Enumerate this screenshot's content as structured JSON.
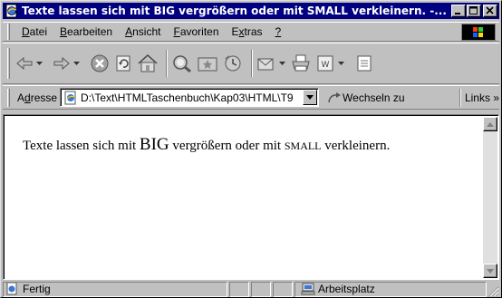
{
  "window": {
    "title": "Texte lassen sich mit BIG vergrößern oder mit SMALL verkleinern. -...",
    "title_bar_color": "#000080"
  },
  "menu": {
    "items": [
      {
        "label": "Datei",
        "accel": "D",
        "rest": "atei"
      },
      {
        "label": "Bearbeiten",
        "accel": "B",
        "rest": "earbeiten"
      },
      {
        "label": "Ansicht",
        "accel": "A",
        "rest": "nsicht"
      },
      {
        "label": "Favoriten",
        "accel": "F",
        "rest": "avoriten"
      },
      {
        "label": "Extras",
        "pre": "E",
        "accel": "x",
        "rest": "tras"
      },
      {
        "label": "?",
        "accel": "?",
        "rest": ""
      }
    ]
  },
  "toolbar": {
    "icons": [
      "back-icon",
      "forward-icon",
      "stop-icon",
      "refresh-icon",
      "home-icon",
      "search-icon",
      "favorites-icon",
      "history-icon",
      "mail-icon",
      "print-icon",
      "edit-icon",
      "discuss-icon"
    ]
  },
  "address": {
    "label_pre": "A",
    "label_accel": "d",
    "label_rest": "resse",
    "value": "D:\\Text\\HTMLTaschenbuch\\Kap03\\HTML\\T9",
    "go_label": "Wechseln zu",
    "links_label": "Links »"
  },
  "document": {
    "part1": "Texte lassen sich mit ",
    "big": "BIG",
    "part2": " vergrößern oder mit ",
    "small": "SMALL",
    "part3": " verkleinern."
  },
  "status": {
    "text": "Fertig",
    "zone": "Arbeitsplatz"
  }
}
